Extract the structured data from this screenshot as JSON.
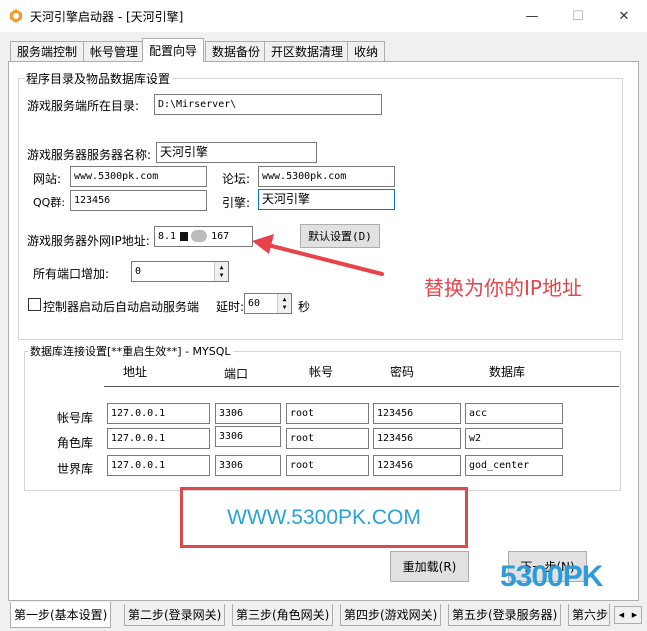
{
  "window": {
    "title": "天河引擎启动器 - [天河引擎]",
    "minimize_glyph": "—",
    "maximize_glyph": "☐",
    "close_glyph": "✕"
  },
  "main_tabs": [
    "服务端控制",
    "帐号管理",
    "配置向导",
    "数据备份",
    "开区数据清理",
    "收纳"
  ],
  "active_tab": "配置向导",
  "program_group": {
    "title": "程序目录及物品数据库设置",
    "server_dir_label": "游戏服务端所在目录:",
    "server_dir_value": "D:\\Mirserver\\",
    "server_name_label": "游戏服务器服务器名称:",
    "server_name_value": "天河引擎",
    "website_label": "网站:",
    "website_value": "www.5300pk.com",
    "forum_label": "论坛:",
    "forum_value": "www.5300pk.com",
    "qq_label": "QQ群:",
    "qq_value": "123456",
    "engine_label": "引擎:",
    "engine_value": "天河引擎",
    "ip_label": "游戏服务器外网IP地址:",
    "ip_value_left": "8.1",
    "ip_value_right": "167",
    "default_button": "默认设置(D)",
    "port_increment_label": "所有端口增加:",
    "port_increment_value": "0",
    "autostart_label": "控制器启动后自动启动服务端",
    "delay_label": "延时:",
    "delay_value": "60",
    "delay_unit": "秒"
  },
  "annotation": {
    "text": "替换为你的IP地址",
    "color": "#e8434a"
  },
  "db_group": {
    "title": "数据库连接设置[**重启生效**] - MYSQL",
    "columns": [
      "地址",
      "端口",
      "帐号",
      "密码",
      "数据库"
    ],
    "rows": [
      {
        "label": "帐号库",
        "address": "127.0.0.1",
        "port": "3306",
        "account": "root",
        "password": "123456",
        "database": "acc"
      },
      {
        "label": "角色库",
        "address": "127.0.0.1",
        "port": "3306",
        "account": "root",
        "password": "123456",
        "database": "w2"
      },
      {
        "label": "世界库",
        "address": "127.0.0.1",
        "port": "3306",
        "account": "root",
        "password": "123456",
        "database": "god_center"
      }
    ]
  },
  "overlay_url": "WWW.5300PK.COM",
  "reload_button": "重加载(R)",
  "next_button": "下一步(N)",
  "watermark": "5300PK",
  "bottom_tabs": [
    "第一步(基本设置)",
    "第二步(登录网关)",
    "第三步(角色网关)",
    "第四步(游戏网关)",
    "第五步(登录服务器)",
    "第六步"
  ],
  "active_bottom_tab": "第一步(基本设置)",
  "colors": {
    "accent": "#0078d7",
    "annotation_red": "#e0474f",
    "url_blue": "#27a2dc",
    "watermark_blue": "#2f9bd8"
  }
}
